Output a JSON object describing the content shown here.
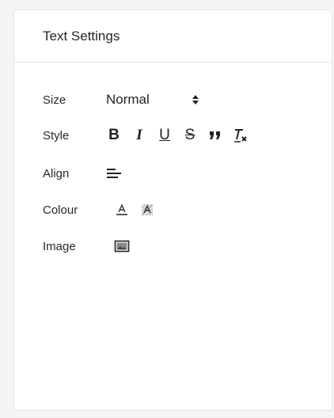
{
  "panel": {
    "title": "Text Settings"
  },
  "rows": {
    "size": {
      "label": "Size",
      "selected": "Normal",
      "icon": "sort-arrows-icon"
    },
    "style": {
      "label": "Style",
      "buttons": [
        {
          "name": "bold",
          "glyph": "B"
        },
        {
          "name": "italic",
          "glyph": "I"
        },
        {
          "name": "underline",
          "glyph": "U"
        },
        {
          "name": "strikethrough",
          "glyph": "S"
        },
        {
          "name": "blockquote",
          "glyph": "❞"
        },
        {
          "name": "clear-format",
          "glyph": "Tx"
        }
      ]
    },
    "align": {
      "label": "Align",
      "icon": "align-left-icon"
    },
    "colour": {
      "label": "Colour",
      "icons": [
        "text-color-icon",
        "background-color-icon"
      ]
    },
    "image": {
      "label": "Image",
      "icon": "image-icon"
    }
  }
}
